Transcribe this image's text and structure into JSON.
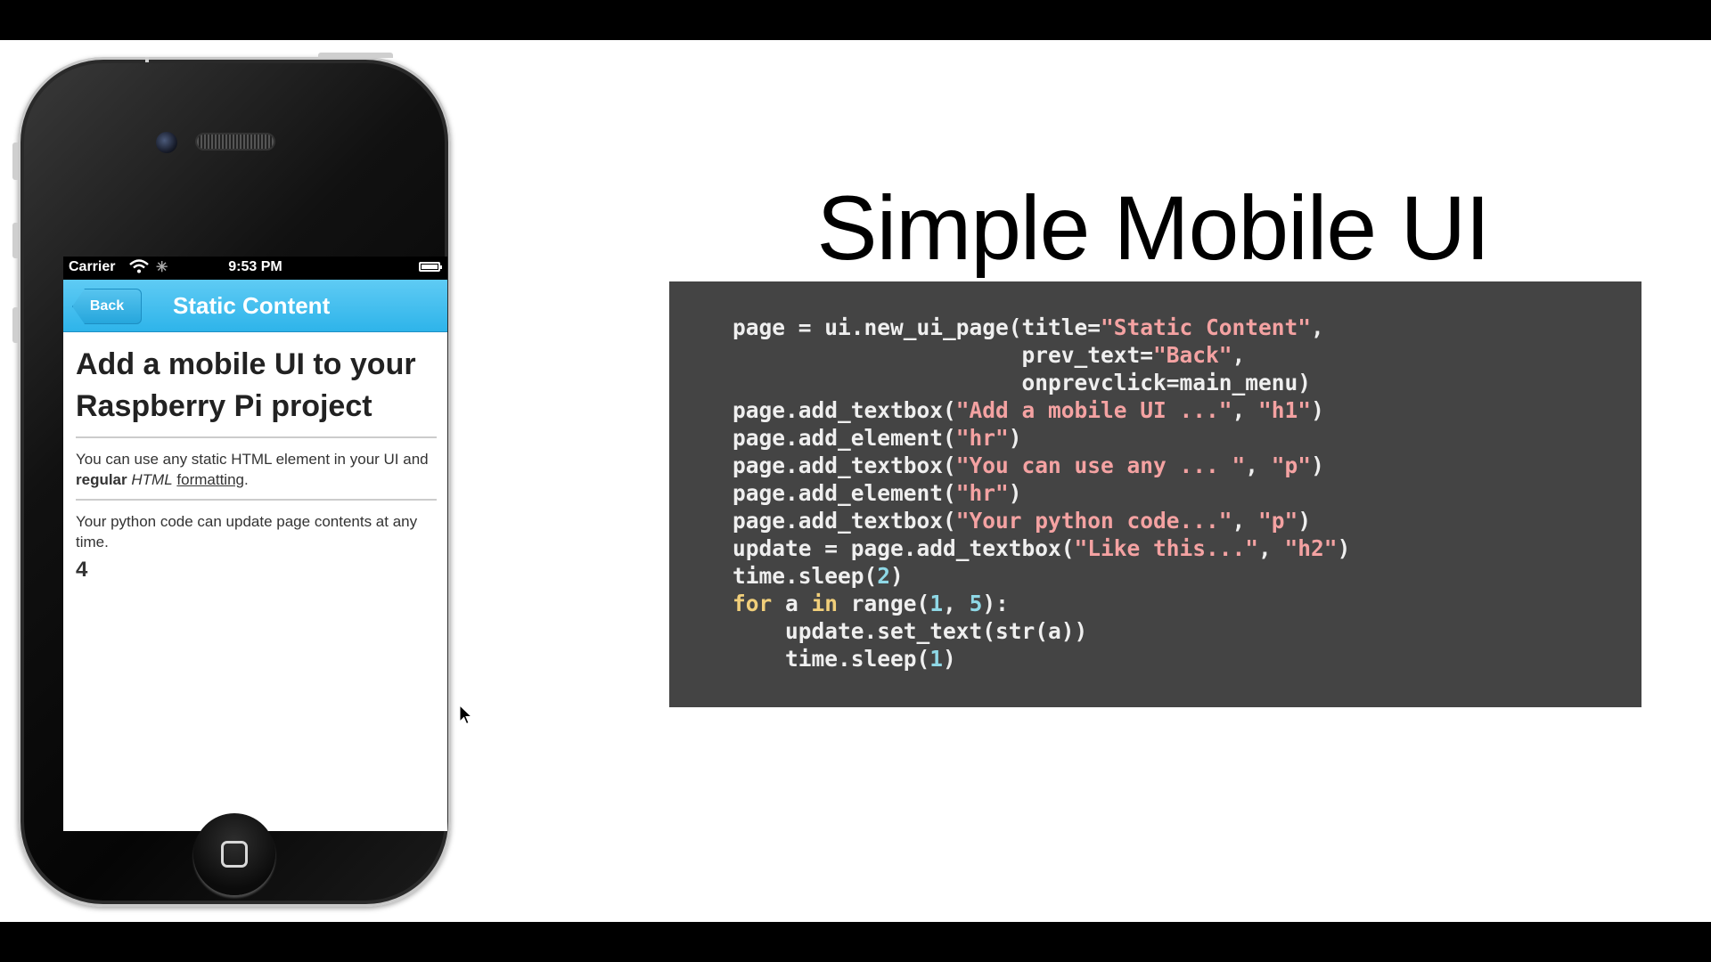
{
  "phone": {
    "status": {
      "carrier": "Carrier",
      "time": "9:53 PM",
      "wifi_icon": "wifi-icon",
      "activity_icon": "spinner-icon",
      "battery_icon": "battery-icon"
    },
    "nav": {
      "back_label": "Back",
      "title": "Static Content"
    },
    "content": {
      "h1": "Add a mobile UI to your Raspberry Pi project",
      "p1": {
        "before": "You can use any static HTML element in your UI and ",
        "bold": "regular",
        "space": " ",
        "italic": "HTML",
        "space2": " ",
        "link": "formatting",
        "after": "."
      },
      "p2": "Your python code can update page contents at any time.",
      "h2": "4"
    }
  },
  "slide": {
    "title": "Simple Mobile UI",
    "code": {
      "lines": [
        [
          [
            "t",
            "page = ui.new_ui_page(title="
          ],
          [
            "s",
            "\"Static Content\""
          ],
          [
            "t",
            ","
          ]
        ],
        [
          [
            "t",
            "                      prev_text="
          ],
          [
            "s",
            "\"Back\""
          ],
          [
            "t",
            ","
          ]
        ],
        [
          [
            "t",
            "                      onprevclick=main_menu)"
          ]
        ],
        [
          [
            "t",
            "page.add_textbox("
          ],
          [
            "s",
            "\"Add a mobile UI ...\""
          ],
          [
            "t",
            ", "
          ],
          [
            "s",
            "\"h1\""
          ],
          [
            "t",
            ")"
          ]
        ],
        [
          [
            "t",
            "page.add_element("
          ],
          [
            "s",
            "\"hr\""
          ],
          [
            "t",
            ")"
          ]
        ],
        [
          [
            "t",
            "page.add_textbox("
          ],
          [
            "s",
            "\"You can use any ... \""
          ],
          [
            "t",
            ", "
          ],
          [
            "s",
            "\"p\""
          ],
          [
            "t",
            ")"
          ]
        ],
        [
          [
            "t",
            "page.add_element("
          ],
          [
            "s",
            "\"hr\""
          ],
          [
            "t",
            ")"
          ]
        ],
        [
          [
            "t",
            "page.add_textbox("
          ],
          [
            "s",
            "\"Your python code...\""
          ],
          [
            "t",
            ", "
          ],
          [
            "s",
            "\"p\""
          ],
          [
            "t",
            ")"
          ]
        ],
        [
          [
            "t",
            "update = page.add_textbox("
          ],
          [
            "s",
            "\"Like this...\""
          ],
          [
            "t",
            ", "
          ],
          [
            "s",
            "\"h2\""
          ],
          [
            "t",
            ")"
          ]
        ],
        [
          [
            "t",
            "time.sleep("
          ],
          [
            "n",
            "2"
          ],
          [
            "t",
            ")"
          ]
        ],
        [
          [
            "k",
            "for"
          ],
          [
            "t",
            " a "
          ],
          [
            "k",
            "in"
          ],
          [
            "t",
            " range("
          ],
          [
            "n",
            "1"
          ],
          [
            "t",
            ", "
          ],
          [
            "n",
            "5"
          ],
          [
            "t",
            "):"
          ]
        ],
        [
          [
            "t",
            "    update.set_text(str(a))"
          ]
        ],
        [
          [
            "t",
            "    time.sleep("
          ],
          [
            "n",
            "1"
          ],
          [
            "t",
            ")"
          ]
        ]
      ]
    }
  }
}
